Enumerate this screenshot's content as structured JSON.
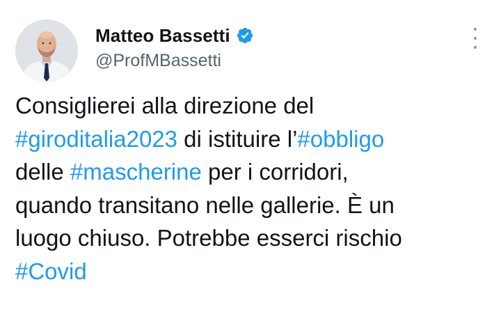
{
  "tweet": {
    "display_name": "Matteo Bassetti",
    "handle": "@ProfMBassetti",
    "verified": true,
    "avatar_icon": "profile-photo",
    "menu_icon": "more-vertical-icon",
    "accent_color": "#1d9bf0",
    "text_lines": [
      [
        {
          "text": "Consiglierei alla direzione del",
          "hashtag": false
        }
      ],
      [
        {
          "text": "#giroditalia2023",
          "hashtag": true
        },
        {
          "text": " di istituire l’",
          "hashtag": false
        },
        {
          "text": "#obbligo",
          "hashtag": true
        }
      ],
      [
        {
          "text": "delle ",
          "hashtag": false
        },
        {
          "text": "#mascherine",
          "hashtag": true
        },
        {
          "text": " per i corridori,",
          "hashtag": false
        }
      ],
      [
        {
          "text": "quando transitano nelle gallerie. È un",
          "hashtag": false
        }
      ],
      [
        {
          "text": "luogo chiuso. Potrebbe esserci rischio",
          "hashtag": false
        }
      ],
      [
        {
          "text": "#Covid",
          "hashtag": true
        }
      ]
    ]
  }
}
